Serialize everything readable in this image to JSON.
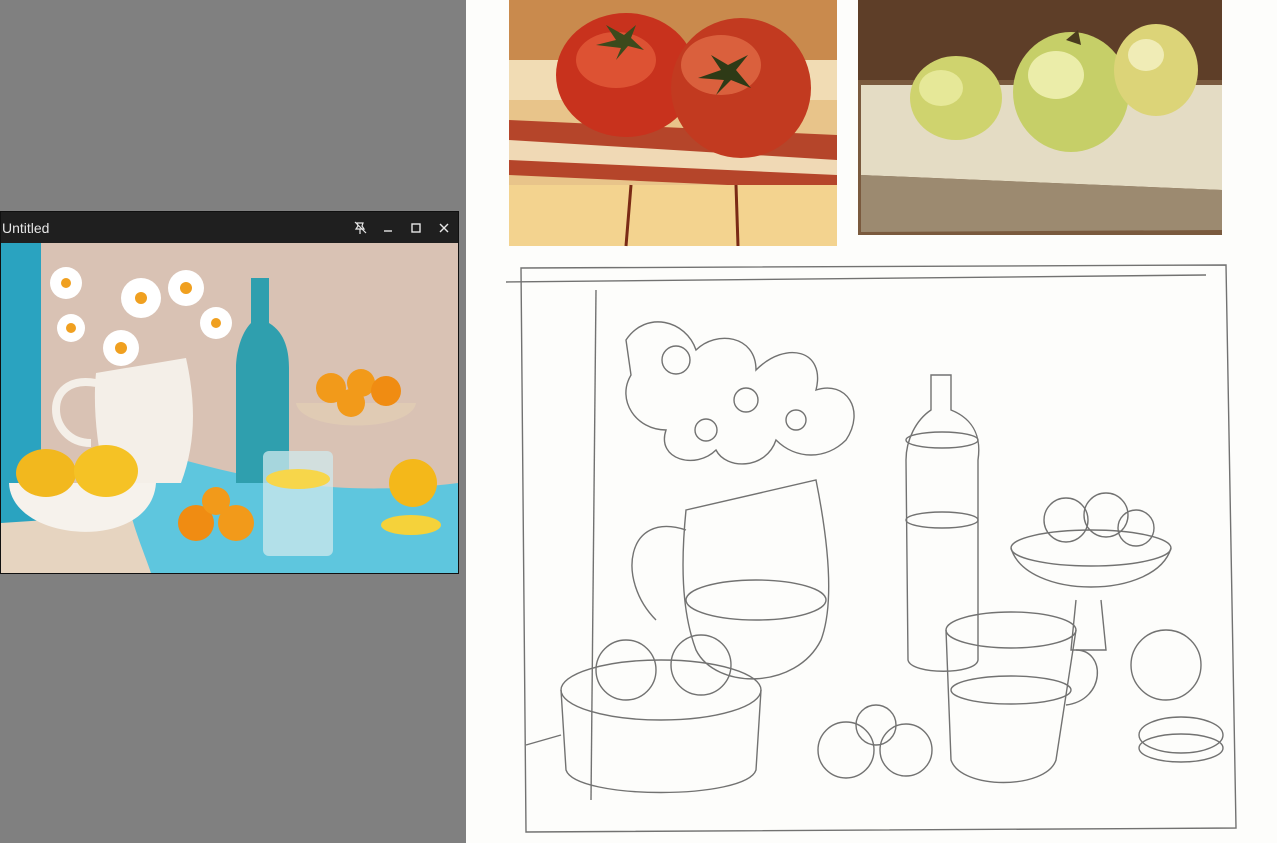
{
  "window": {
    "title": "Untitled",
    "buttons": {
      "pin": "pin-off-icon",
      "minimize": "minimize-icon",
      "maximize": "maximize-icon",
      "close": "close-icon"
    }
  },
  "colors": {
    "workspace": "#808080",
    "canvas": "#fdfdfb",
    "titlebar": "#1f1f1f",
    "title_text": "#e6e6e6"
  }
}
